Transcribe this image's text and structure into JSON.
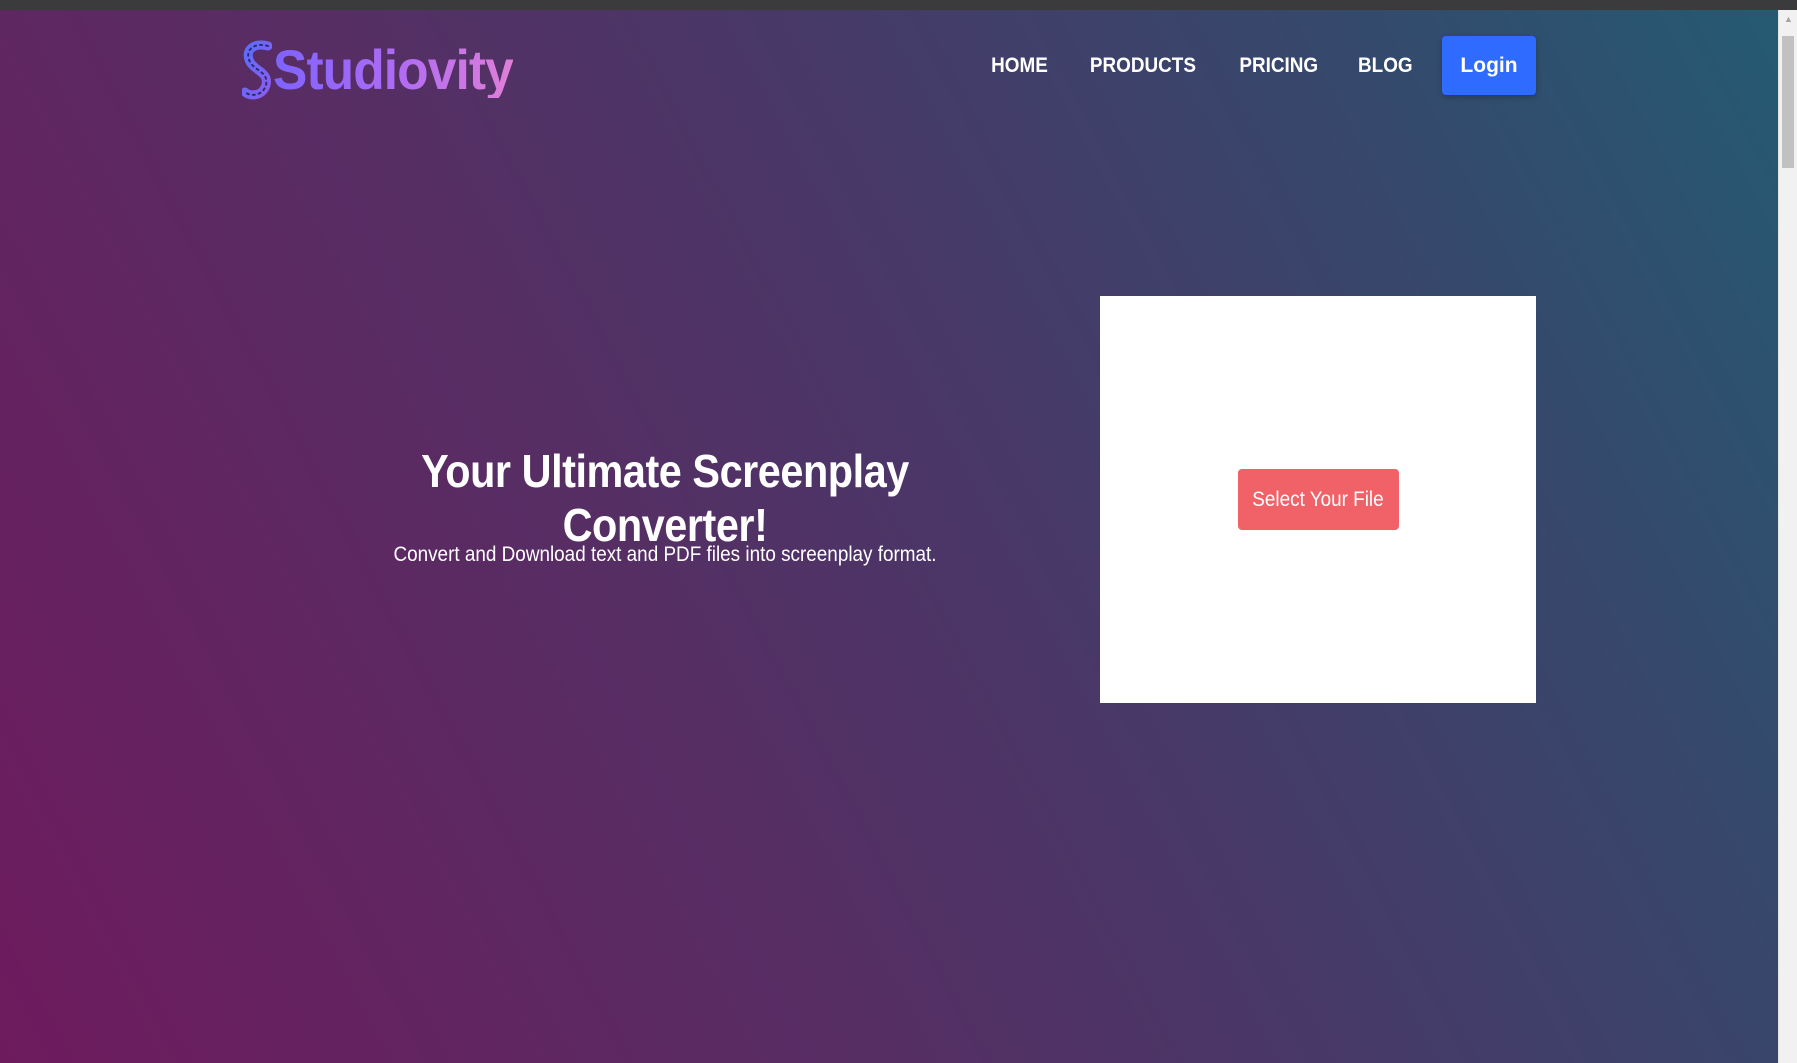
{
  "brand": {
    "name": "Studiovity",
    "icon": "film-strip-s-icon"
  },
  "nav": {
    "items": [
      "HOME",
      "PRODUCTS",
      "PRICING",
      "BLOG"
    ],
    "login_label": "Login"
  },
  "hero": {
    "title": "Your Ultimate Screenplay Converter!",
    "subtitle": "Convert and Download text and PDF files into screenplay format."
  },
  "upload": {
    "button_label": "Select Your File"
  },
  "colors": {
    "login_button": "#2f6bff",
    "select_button": "#f16268",
    "background_start": "#6e1b5e",
    "background_end": "#255a72"
  }
}
